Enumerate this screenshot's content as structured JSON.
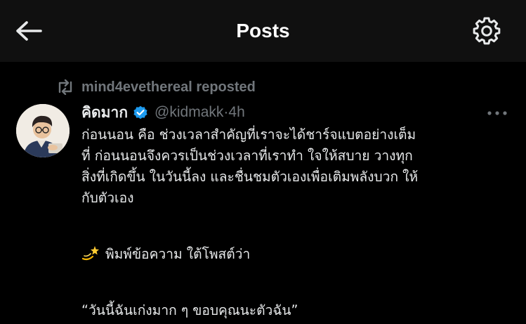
{
  "header": {
    "title": "Posts",
    "back_icon": "arrow-left-icon",
    "settings_icon": "gear-icon"
  },
  "repost": {
    "icon": "repost-icon",
    "text": "mind4evethereal reposted"
  },
  "post": {
    "avatar_icon": "avatar",
    "display_name": "คิดมาก",
    "verified_icon": "verified-badge-icon",
    "handle": "@kidmakk",
    "separator": " · ",
    "time": "4h",
    "more_icon": "more-icon",
    "lines": [
      "ก่อนนอน คือ ช่วงเวลาสำคัญที่เราจะได้ชาร์จแบตอย่างเต็ม",
      "ที่ ก่อนนอนจึงควรเป็นช่วงเวลาที่เราทำ ใจให้สบาย วางทุก",
      "สิ่งที่เกิดขึ้น ในวันนี้ลง และชื่นชมตัวเองเพื่อเติมพลังบวก ให้",
      "กับตัวเอง"
    ],
    "emoji_icon": "dizzy-star-icon",
    "instruction": "พิมพ์ข้อความ ใต้โพสต์ว่า",
    "quote": "“วันนี้ฉันเก่งมาก ๆ ขอบคุณนะตัวฉัน”"
  },
  "colors": {
    "background": "#000000",
    "topbar": "#101010",
    "text": "#e7e9ea",
    "muted": "#71767b",
    "verified": "#1d9bf0"
  }
}
